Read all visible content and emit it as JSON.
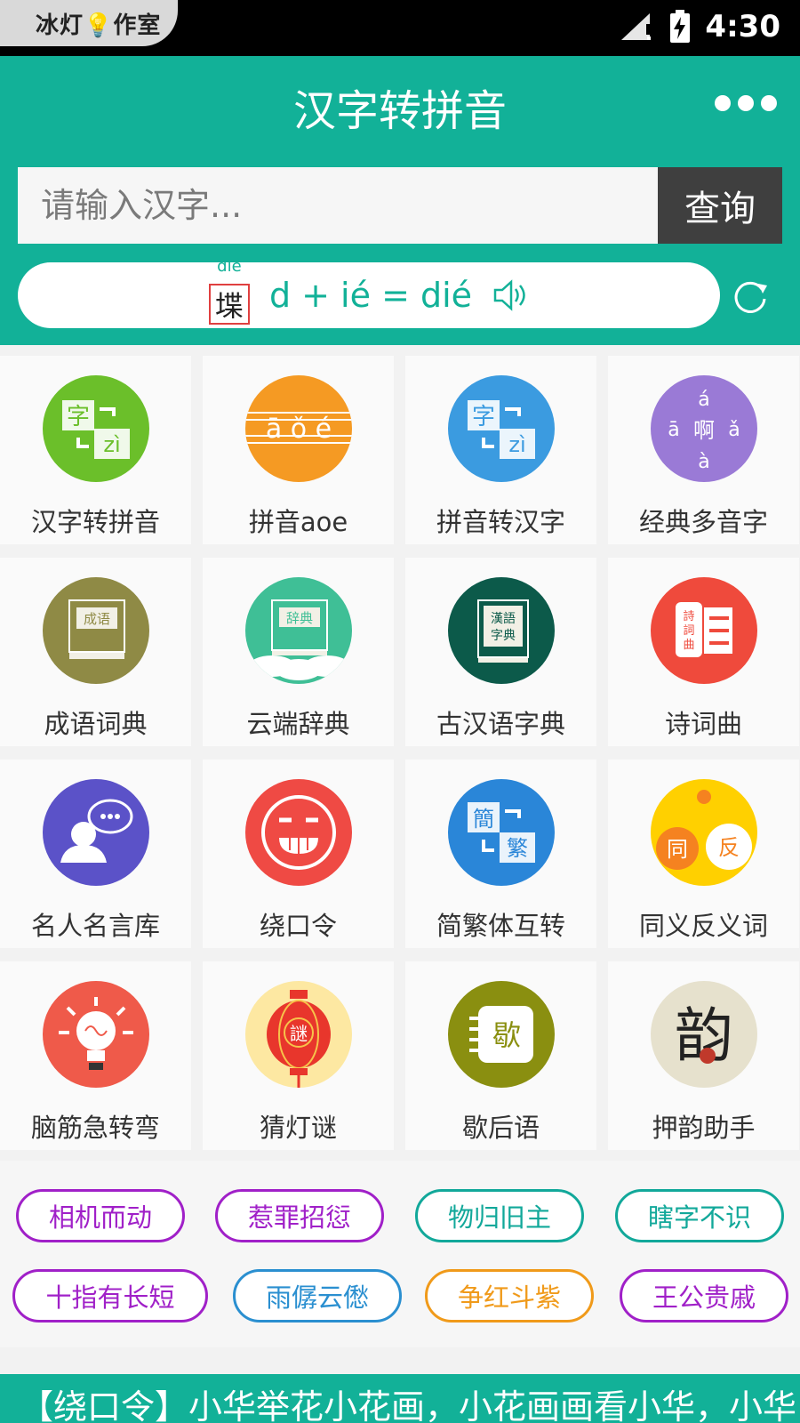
{
  "status_bar": {
    "watermark": "冰灯💡作室",
    "time": "4:30"
  },
  "header": {
    "title": "汉字转拼音",
    "menu_icon": "more-dots-icon"
  },
  "search": {
    "placeholder": "请输入汉字...",
    "button_label": "查询"
  },
  "pinyin_demo": {
    "character": "堞",
    "pinyin": "dié",
    "formula": "d + ié = dié"
  },
  "grid": {
    "items": [
      {
        "label": "汉字转拼音",
        "icon": "hanzi-to-pinyin-icon",
        "color": "#6bbf2a"
      },
      {
        "label": "拼音aoe",
        "icon": "pinyin-aoe-icon",
        "color": "#f59a23"
      },
      {
        "label": "拼音转汉字",
        "icon": "pinyin-to-hanzi-icon",
        "color": "#3b9be0"
      },
      {
        "label": "经典多音字",
        "icon": "polyphonic-icon",
        "color": "#9a7ad6"
      },
      {
        "label": "成语词典",
        "icon": "idiom-dictionary-icon",
        "color": "#8f8a45"
      },
      {
        "label": "云端辞典",
        "icon": "cloud-dictionary-icon",
        "color": "#3fbf96"
      },
      {
        "label": "古汉语字典",
        "icon": "classical-chinese-dictionary-icon",
        "color": "#0c5a4a"
      },
      {
        "label": "诗词曲",
        "icon": "poetry-icon",
        "color": "#ef4a3c"
      },
      {
        "label": "名人名言库",
        "icon": "famous-quotes-icon",
        "color": "#5b52c8"
      },
      {
        "label": "绕口令",
        "icon": "tongue-twister-icon",
        "color": "#ef4a44"
      },
      {
        "label": "简繁体互转",
        "icon": "simplified-traditional-icon",
        "color": "#2a86d8"
      },
      {
        "label": "同义反义词",
        "icon": "synonym-antonym-icon",
        "color": "#ffd000"
      },
      {
        "label": "脑筋急转弯",
        "icon": "brain-teaser-icon",
        "color": "#ef5a4a"
      },
      {
        "label": "猜灯谜",
        "icon": "lantern-riddle-icon",
        "color": "#fde8a2"
      },
      {
        "label": "歇后语",
        "icon": "xiehouyu-icon",
        "color": "#8a8f10"
      },
      {
        "label": "押韵助手",
        "icon": "rhyme-helper-icon",
        "color": "#e6e1cd"
      }
    ]
  },
  "tags": [
    {
      "label": "相机而动",
      "color": "#a020c8"
    },
    {
      "label": "惹罪招愆",
      "color": "#a020c8"
    },
    {
      "label": "物归旧主",
      "color": "#12a89a"
    },
    {
      "label": "瞎字不识",
      "color": "#12a89a"
    },
    {
      "label": "十指有长短",
      "color": "#a020c8"
    },
    {
      "label": "雨僝云僽",
      "color": "#2a8fd0"
    },
    {
      "label": "争红斗紫",
      "color": "#f09a1a"
    },
    {
      "label": "王公贵戚",
      "color": "#a020c8"
    }
  ],
  "marquee": {
    "text": "【绕口令】小华举花小花画，小花画画看小华，小华"
  },
  "colors": {
    "primary": "#12b198",
    "search_button": "#3f3f3f"
  }
}
